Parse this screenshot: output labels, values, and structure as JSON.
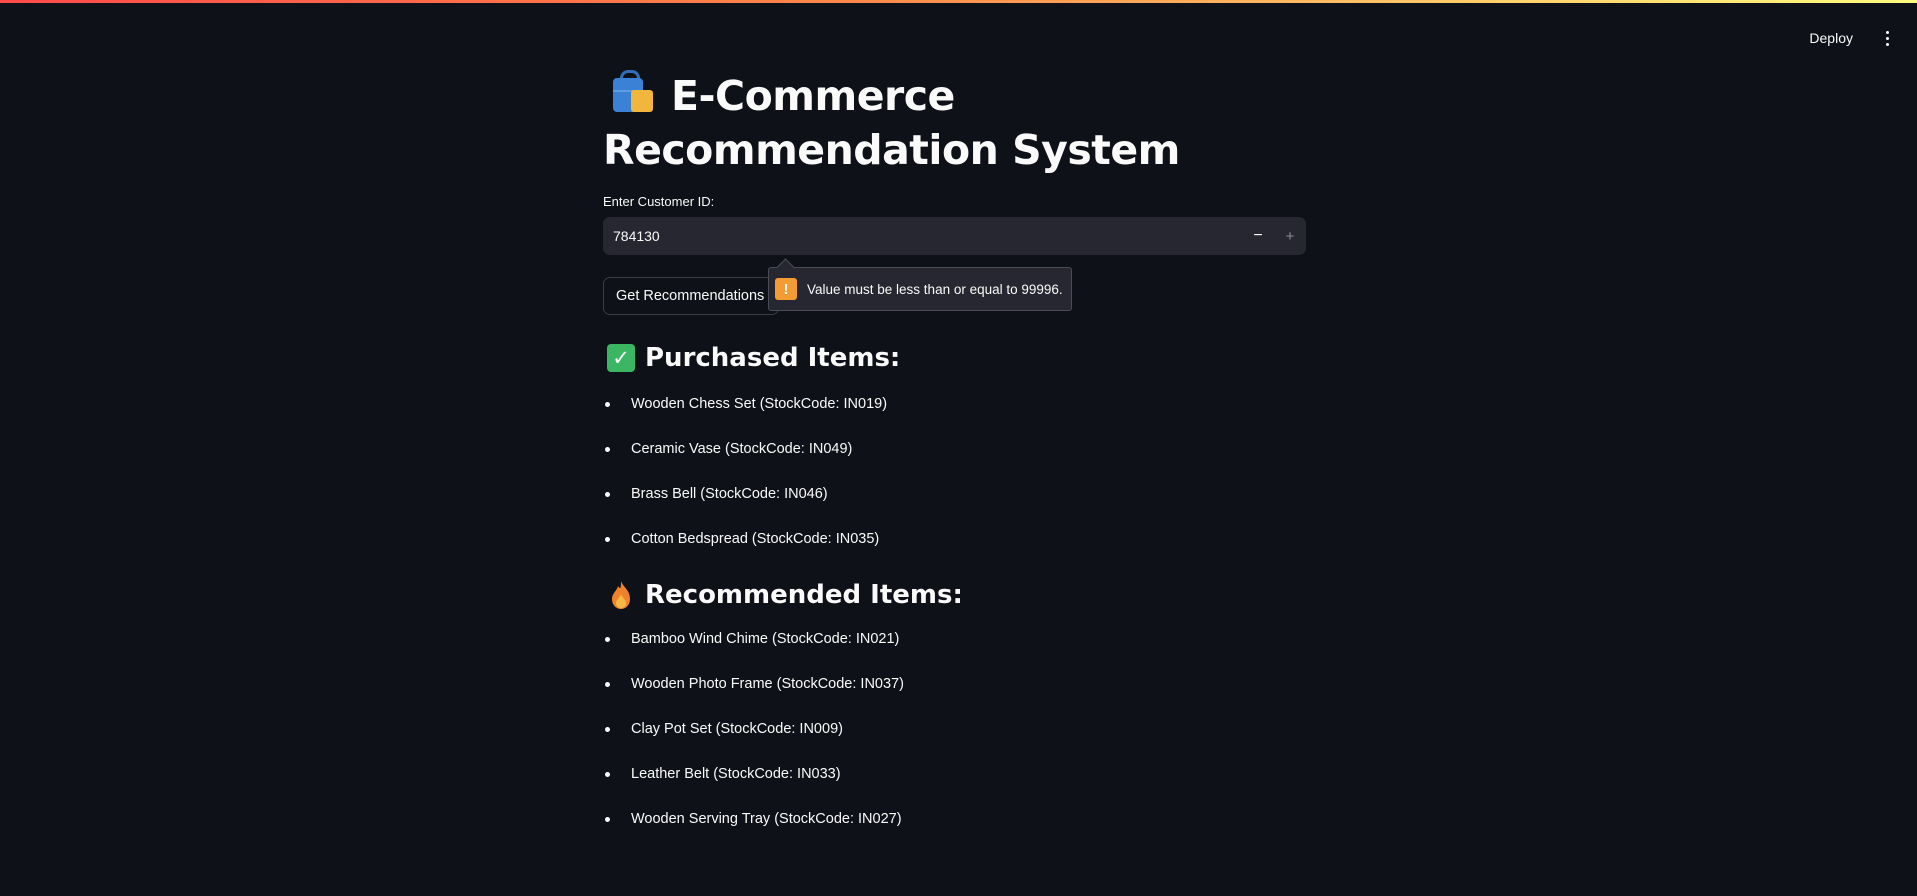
{
  "header": {
    "deploy_label": "Deploy",
    "menu_icon": "kebab-menu-icon"
  },
  "app": {
    "title": "E-Commerce Recommendation System",
    "title_icon": "shopping-bags-icon"
  },
  "form": {
    "customer_id_label": "Enter Customer ID:",
    "customer_id_value": "784130",
    "decrement_label": "−",
    "increment_label": "+",
    "submit_label": "Get Recommendations",
    "validation_message": "Value must be less than or equal to 99996.",
    "validation_icon": "!"
  },
  "purchased": {
    "heading": "Purchased Items:",
    "icon": "check-mark-icon",
    "items": [
      "Wooden Chess Set (StockCode: IN019)",
      "Ceramic Vase (StockCode: IN049)",
      "Brass Bell (StockCode: IN046)",
      "Cotton Bedspread (StockCode: IN035)"
    ]
  },
  "recommended": {
    "heading": "Recommended Items:",
    "icon": "fire-icon",
    "items": [
      "Bamboo Wind Chime (StockCode: IN021)",
      "Wooden Photo Frame (StockCode: IN037)",
      "Clay Pot Set (StockCode: IN009)",
      "Leather Belt (StockCode: IN033)",
      "Wooden Serving Tray (StockCode: IN027)"
    ]
  },
  "colors": {
    "background": "#0e1117",
    "input_bg": "#262730",
    "check": "#3bb662",
    "warning": "#f39c34"
  }
}
